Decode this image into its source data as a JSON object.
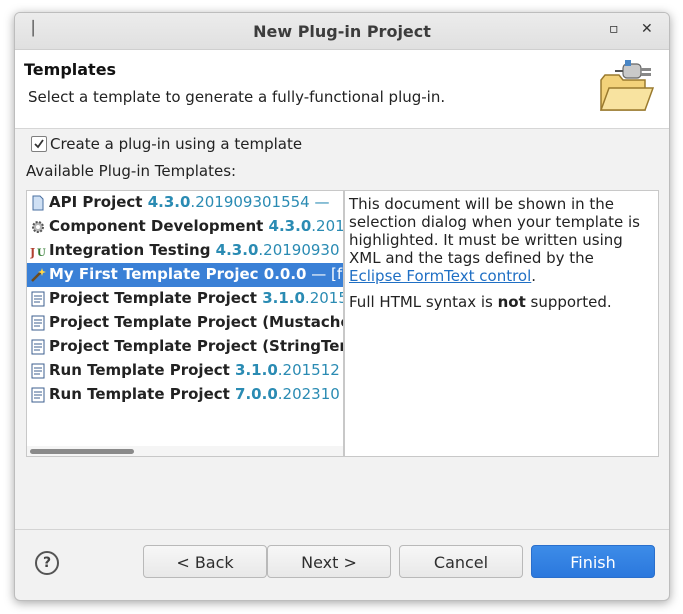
{
  "window": {
    "title": "New Plug-in Project",
    "menu_icon": "│",
    "minimize_icon": "▫",
    "close_icon": "✕"
  },
  "banner": {
    "title": "Templates",
    "description": "Select a template to generate a fully-functional plug-in.",
    "icon": "plugin-folder-icon"
  },
  "checkbox": {
    "label": "Create a plug-in using a template",
    "checked": true
  },
  "available_label": "Available Plug-in Templates:",
  "templates": [
    {
      "name": "API Project ",
      "version": "4.3.0",
      "rest": ".201909301554 —",
      "icon": "document-icon"
    },
    {
      "name": "Component Development ",
      "version": "4.3.0",
      "rest": ".201",
      "icon": "gear-icon"
    },
    {
      "name": "Integration Testing ",
      "version": "4.3.0",
      "rest": ".20190930",
      "icon": "junit-icon"
    },
    {
      "name": "My First Template Projec 0.0.0",
      "version": "",
      "rest": " — [f",
      "icon": "wand-icon",
      "selected": true
    },
    {
      "name": "Project Template Project ",
      "version": "3.1.0",
      "rest": ".2015",
      "icon": "template-icon"
    },
    {
      "name": "Project Template Project (Mustache",
      "version": "",
      "rest": "",
      "icon": "template-icon"
    },
    {
      "name": "Project Template Project (StringTer",
      "version": "",
      "rest": "",
      "icon": "template-icon"
    },
    {
      "name": "Run Template Project ",
      "version": "3.1.0",
      "rest": ".201512",
      "icon": "template-icon"
    },
    {
      "name": "Run Template Project ",
      "version": "7.0.0",
      "rest": ".202310",
      "icon": "template-icon"
    }
  ],
  "description": {
    "p1_before_link": "This document will be shown in the selection dialog when your template is highlighted. It must be written using XML and the tags defined by the ",
    "p1_link": "Eclipse FormText control",
    "p1_after_link": ".",
    "p2_before": "Full HTML syntax is ",
    "p2_bold": "not",
    "p2_after": " supported."
  },
  "buttons": {
    "help": "?",
    "back": "< Back",
    "next": "Next >",
    "cancel": "Cancel",
    "finish": "Finish"
  },
  "colors": {
    "accent": "#3a80d6",
    "version": "#2a8bb3",
    "link": "#1f6fc4"
  }
}
